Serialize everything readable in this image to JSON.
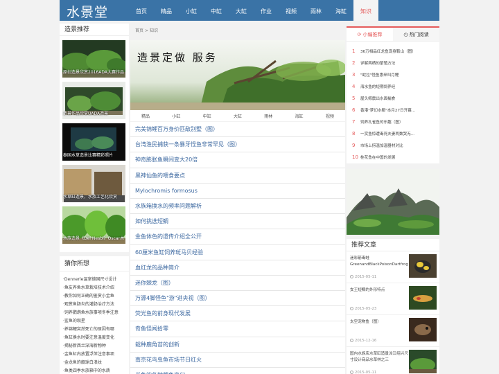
{
  "header": {
    "logo": "水景堂",
    "nav": [
      "首页",
      "精品",
      "小缸",
      "中缸",
      "大缸",
      "作业",
      "视频",
      "雨林",
      "海缸",
      "知识"
    ],
    "active_nav": "知识"
  },
  "left": {
    "rec_title": "造景推荐",
    "rec_items": [
      "原创造景欣赏2016ADA大赛作品",
      "造景作品欣赏UADA造景",
      "泰国水草造景比赛精彩照片",
      "水草缸造景，水族工艺化欣赏",
      "水族造景《Del Nesbi》Oscar木"
    ],
    "guess_title": "猜你所想",
    "guess_items": [
      "·Dennerle温室德国尺寸设计",
      "·鱼友养鱼水草栽培技术介绍",
      "·教你如何正确的鉴赏小金鱼",
      "·观赏鱼肠炎的灌肠治疗方法",
      "·饲养鹦鹉鱼水族事项冬季注意",
      "·鲨鱼的观星",
      "·养锦鲤突然死亡的原因有哪",
      "·鱼缸换水时要注意温度变化",
      "·揭秘新西兰深海新物种",
      "·金鱼缸内放置浮萍注意事项",
      "·金龙鱼的靓球白浪纹",
      "·鱼类四季水族箱中的水质"
    ]
  },
  "center": {
    "breadcrumb": [
      "首页",
      "知识"
    ],
    "breadcrumb_sep": ">",
    "banner_text": "造景定做  服务",
    "categories": [
      "精品",
      "小缸",
      "中缸",
      "大缸",
      "雨林",
      "海缸",
      "视频"
    ],
    "articles": [
      "完美锦鲤百万身价匹敌别墅（图）",
      "台湾渔民捕获一条暴牙怪鱼非常罕见（图）",
      "神奇膨胀鱼瞬间变大20倍",
      "黑神仙鱼的喂食要点",
      "Mylochromis formosus",
      "水族箱换水的频率问题解析",
      "如何挑选短鲷",
      "金鱼体色的遗传介绍全公开",
      "60厘米鱼缸饲养斑马贝经验",
      "血红龙的品种简介",
      "迷你棘龙（图）",
      "万源4脚怪鱼\"游\"进央视（图）",
      "荧光鱼的前身现代发展",
      "奇鱼怪闻拾零",
      "栽种鹿角苔的创新",
      "南京花鸟虫鱼市场节日红火",
      "光鱼的各种颜色变幻"
    ]
  },
  "right": {
    "tab_editor": "小编推荐",
    "tab_hot": "热门阅读",
    "rank": [
      {
        "n": "1",
        "t": "36万相品红龙鱼现身鞍山（图）"
      },
      {
        "n": "2",
        "t": "详解两栖的繁殖方法"
      },
      {
        "n": "3",
        "t": "\"蛇拉\"怪鱼惠来叫月鲤"
      },
      {
        "n": "4",
        "t": "海水鱼的短期饲养经"
      },
      {
        "n": "5",
        "t": "屋头鲸震出水面捕食"
      },
      {
        "n": "6",
        "t": "香港\"梦幻水都\"本月27日开幕..."
      },
      {
        "n": "7",
        "t": "饲养孔雀鱼的乐趣（图）"
      },
      {
        "n": "8",
        "t": "一赏鱼惊遭毒死夫妻两数哭无..."
      },
      {
        "n": "9",
        "t": "市场上捞温加温器材对比"
      },
      {
        "n": "10",
        "t": "桂花鱼在中国的发展"
      }
    ],
    "rec_title": "推荐文章",
    "rec_articles": [
      {
        "title": "迷彩箭毒蛙GreenandBlackPoisonDartfrog",
        "date": "2015-05-11"
      },
      {
        "title": "女王短鲷的外形特点",
        "date": "2015-05-23"
      },
      {
        "title": "太空宠物鱼（图）",
        "date": "2015-12-16"
      },
      {
        "title": "国内水族店水草缸造景派江绍兴尺寸设计商品水草林之三",
        "date": "2015-05-11"
      }
    ]
  },
  "colors": {
    "primary": "#3a73a6",
    "accent": "#e55a5a",
    "link": "#3c68a0"
  }
}
